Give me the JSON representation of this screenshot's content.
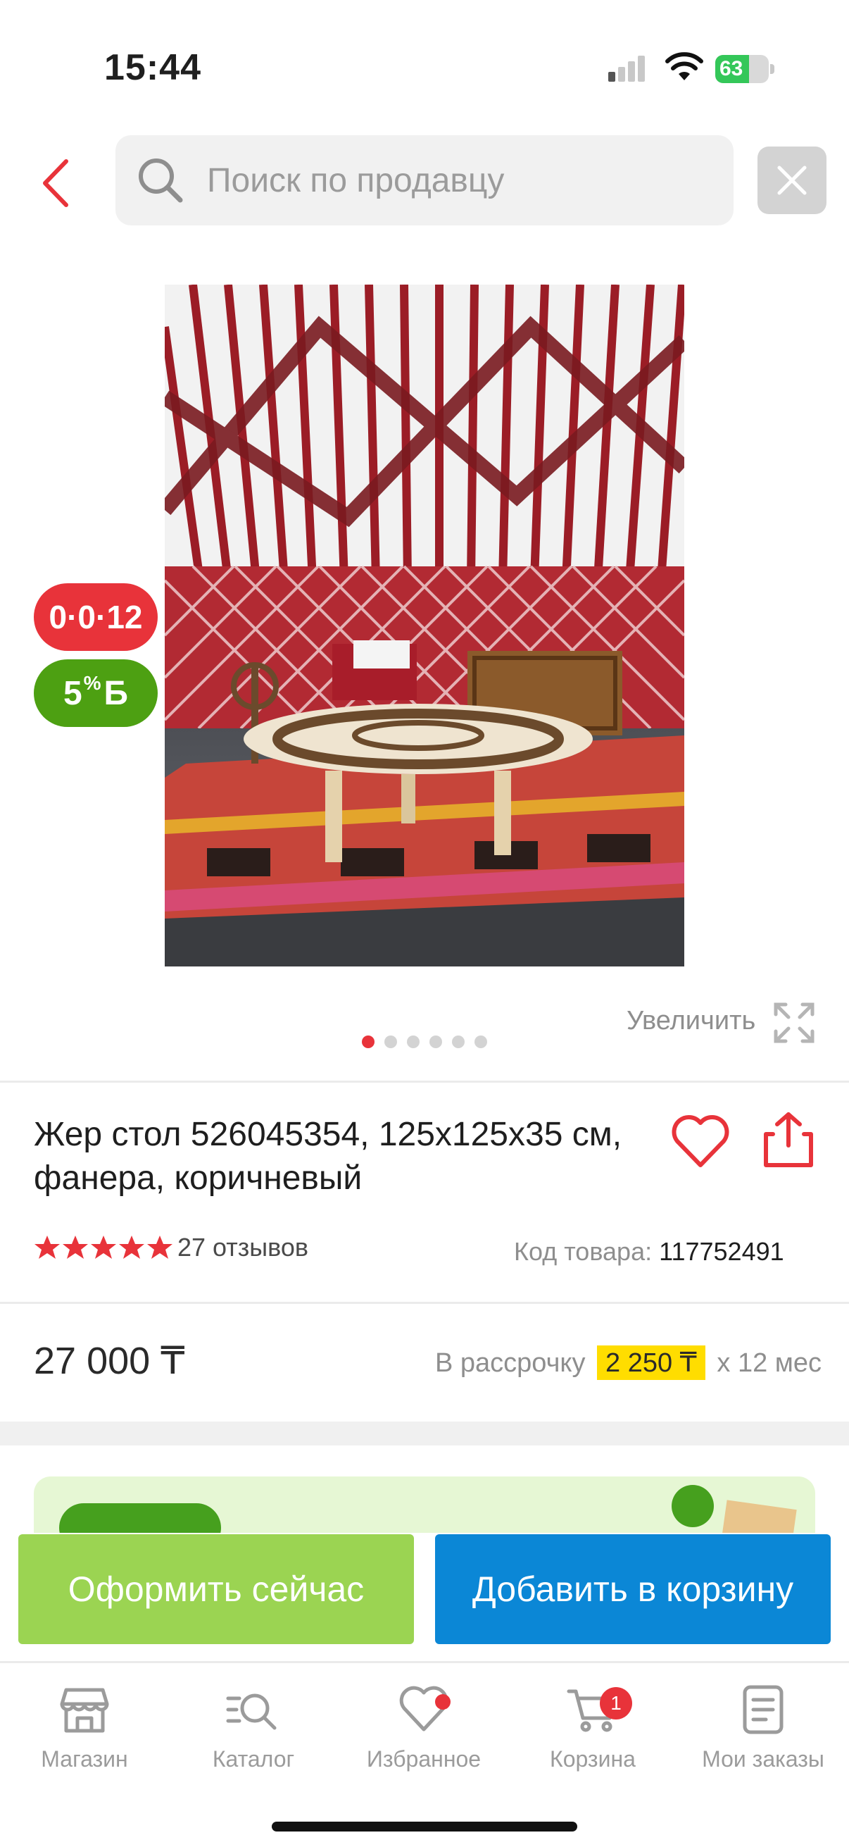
{
  "status_bar": {
    "time": "15:44",
    "battery": "63",
    "battery_level": 0.63
  },
  "search": {
    "placeholder": "Поиск по продавцу"
  },
  "badges": {
    "installment": "0·0·12",
    "bonus_value": "5",
    "bonus_percent": "%",
    "bonus_currency": "Б"
  },
  "gallery": {
    "zoom_label": "Увеличить",
    "dots_total": 6,
    "active_dot": 0
  },
  "product": {
    "title": "Жер стол 526045354, 125x125x35 см, фанера, коричневый",
    "rating": 5,
    "reviews": "27 отзывов",
    "code_label": "Код товара:",
    "code_value": "117752491",
    "price": "27 000 ₸",
    "installment_prefix": "В рассрочку",
    "installment_amount": "2 250 ₸",
    "installment_suffix": "x 12 мес"
  },
  "actions": {
    "checkout": "Оформить сейчас",
    "add_to_cart": "Добавить в корзину"
  },
  "tabbar": {
    "items": [
      {
        "label": "Магазин",
        "icon": "shop-icon"
      },
      {
        "label": "Каталог",
        "icon": "catalog-icon"
      },
      {
        "label": "Избранное",
        "icon": "heart-icon"
      },
      {
        "label": "Корзина",
        "icon": "cart-icon",
        "badge": "1"
      },
      {
        "label": "Мои заказы",
        "icon": "orders-icon"
      }
    ]
  },
  "colors": {
    "accent_red": "#e8333a",
    "brand_blue": "#0b87d6",
    "checkout_green": "#9bd452",
    "bonus_green": "#4da012",
    "installment_yellow": "#ffdd00"
  }
}
